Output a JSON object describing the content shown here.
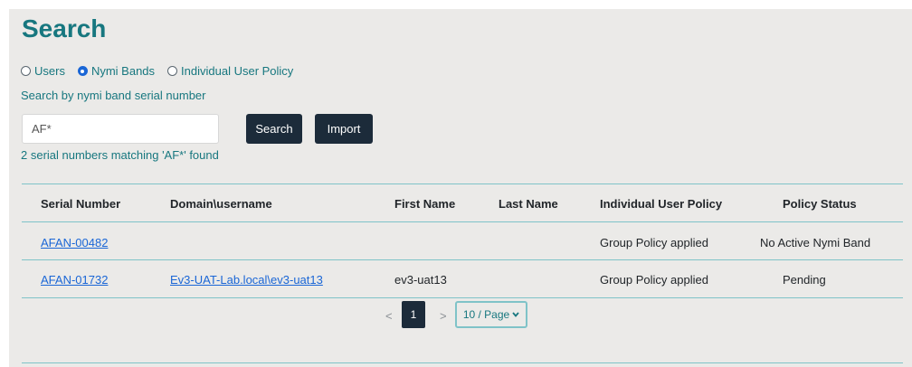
{
  "page": {
    "title": "Search"
  },
  "search_type": {
    "options": [
      {
        "label": "Users",
        "checked": false
      },
      {
        "label": "Nymi Bands",
        "checked": true
      },
      {
        "label": "Individual User Policy",
        "checked": false
      }
    ],
    "hint": "Search by nymi band serial number"
  },
  "search": {
    "value": "AF*",
    "search_label": "Search",
    "import_label": "Import",
    "result_message": "2 serial numbers matching 'AF*' found"
  },
  "table": {
    "headers": [
      "Serial Number",
      "Domain\\username",
      "First Name",
      "Last Name",
      "Individual User Policy",
      "Policy Status"
    ],
    "rows": [
      {
        "serial": "AFAN-00482",
        "domain_user": "",
        "first_name": "",
        "last_name": "",
        "policy": "Group Policy applied",
        "status": "No Active Nymi Band"
      },
      {
        "serial": "AFAN-01732",
        "domain_user": "Ev3-UAT-Lab.local\\ev3-uat13",
        "first_name": "ev3-uat13",
        "last_name": "",
        "policy": "Group Policy applied",
        "status": "Pending"
      }
    ]
  },
  "pagination": {
    "prev": "<",
    "current_page": "1",
    "next": ">",
    "page_size": "10 / Page"
  },
  "colors": {
    "accent": "#17777f",
    "button": "#1c2b3a",
    "link": "#1a66d6",
    "divider": "#7fc3c8",
    "background": "#ebeae8"
  }
}
